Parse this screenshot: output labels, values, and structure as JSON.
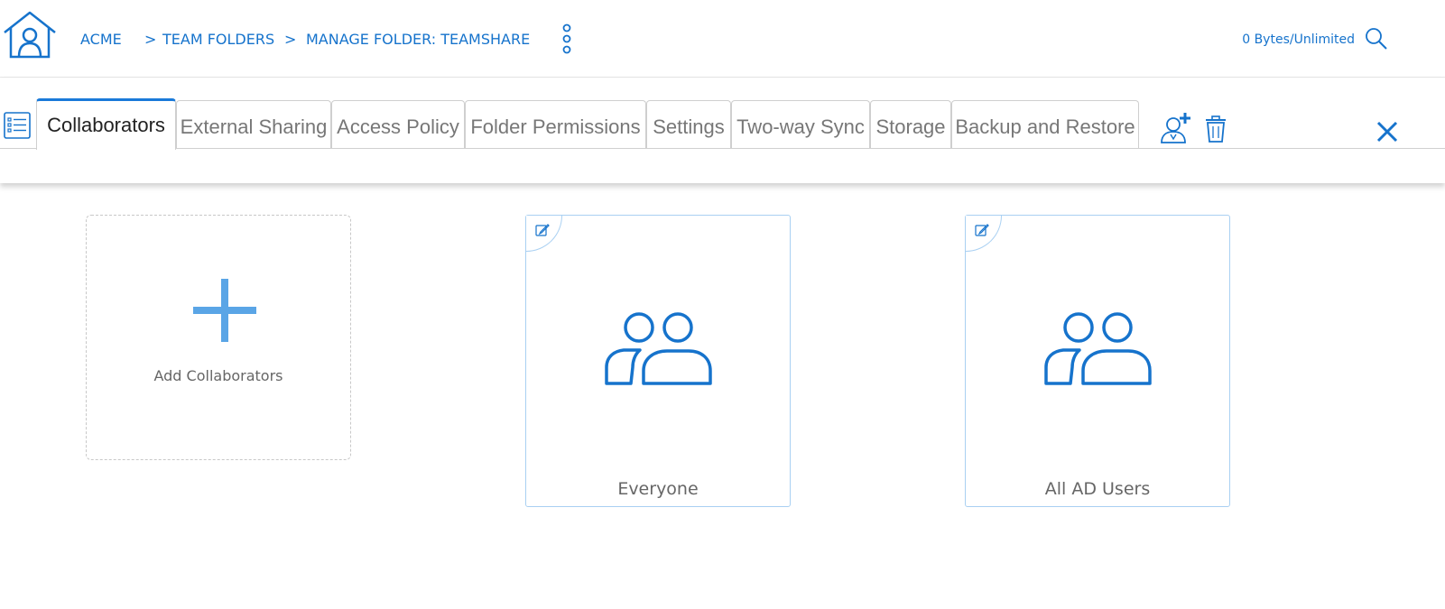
{
  "header": {
    "breadcrumb_root": "ACME",
    "breadcrumb_sep": ">",
    "breadcrumb_team_folders": "TEAM FOLDERS",
    "breadcrumb_manage": "MANAGE FOLDER: TEAMSHARE",
    "quota": "0 Bytes/Unlimited"
  },
  "tabs": [
    {
      "label": "Collaborators",
      "active": true
    },
    {
      "label": "External Sharing",
      "active": false
    },
    {
      "label": "Access Policy",
      "active": false
    },
    {
      "label": "Folder Permissions",
      "active": false
    },
    {
      "label": "Settings",
      "active": false
    },
    {
      "label": "Two-way Sync",
      "active": false
    },
    {
      "label": "Storage",
      "active": false
    },
    {
      "label": "Backup and Restore",
      "active": false
    }
  ],
  "add_card": {
    "label": "Add Collaborators"
  },
  "collaborators": [
    {
      "name": "Everyone"
    },
    {
      "name": "All AD Users"
    }
  ],
  "icons": {
    "home": "home-icon",
    "more": "more-vertical-icon",
    "search": "search-icon",
    "list": "list-view-icon",
    "add_user": "add-user-icon",
    "trash": "trash-icon",
    "close": "close-icon",
    "plus": "plus-icon",
    "edit": "edit-icon",
    "group": "group-icon"
  },
  "colors": {
    "accent": "#1673cc",
    "plus": "#5aa5e6",
    "card_border": "#a9d0f2",
    "active_tab_border": "#1a7ad9"
  }
}
